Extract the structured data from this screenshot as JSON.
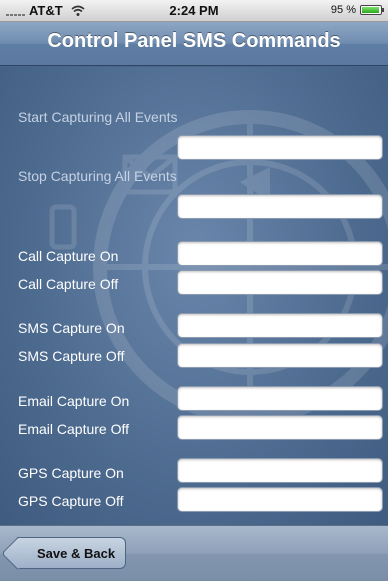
{
  "status_bar": {
    "carrier": "AT&T",
    "time": "2:24 PM",
    "battery": "95 %",
    "battery_level": 0.95
  },
  "nav_bar": {
    "title": "Control Panel SMS Commands"
  },
  "fields": [
    {
      "label": "Start Capturing All Events",
      "value": ""
    },
    {
      "label": "Stop Capturing All Events",
      "value": ""
    },
    {
      "label": "Call Capture On",
      "value": ""
    },
    {
      "label": "Call Capture Off",
      "value": ""
    },
    {
      "label": "SMS Capture On",
      "value": ""
    },
    {
      "label": "SMS Capture Off",
      "value": ""
    },
    {
      "label": "Email Capture On",
      "value": ""
    },
    {
      "label": "Email Capture Off",
      "value": ""
    },
    {
      "label": "GPS Capture On",
      "value": ""
    },
    {
      "label": "GPS Capture Off",
      "value": ""
    }
  ],
  "toolbar": {
    "back_label": "Save & Back"
  }
}
